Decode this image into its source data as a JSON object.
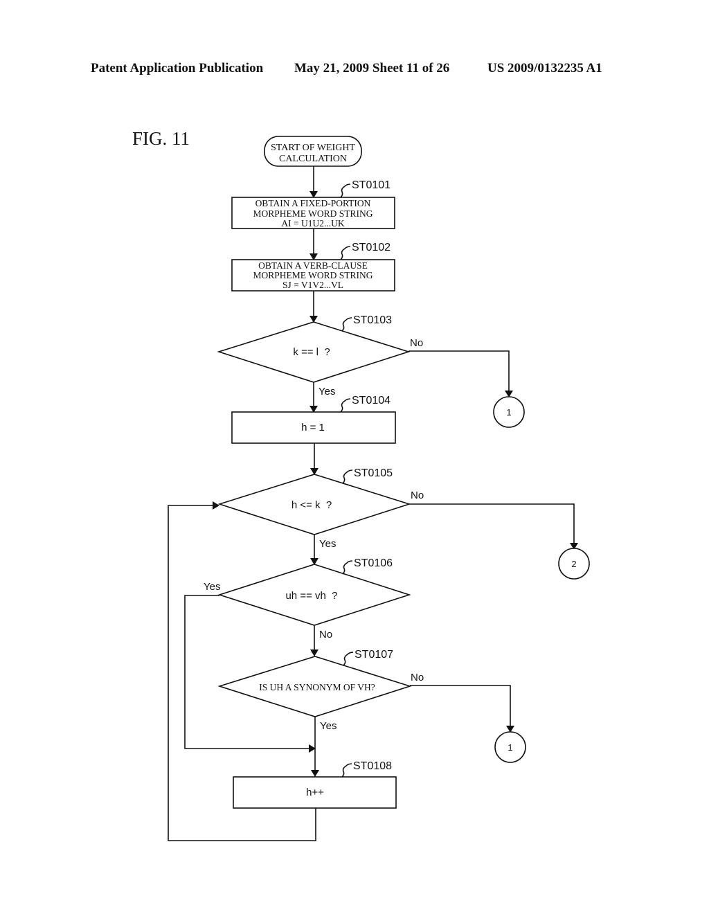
{
  "header": {
    "publication": "Patent Application Publication",
    "date_sheet": "May 21, 2009  Sheet 11 of 26",
    "pub_number": "US 2009/0132235 A1"
  },
  "figure": {
    "label": "FIG. 11",
    "start": {
      "lines": [
        "START OF WEIGHT",
        "CALCULATION"
      ]
    },
    "steps": [
      {
        "id": "ST0101",
        "type": "process",
        "lines": [
          "OBTAIN A FIXED-PORTION",
          "MORPHEME WORD STRING",
          "AI = U1U2...UK"
        ]
      },
      {
        "id": "ST0102",
        "type": "process",
        "lines": [
          "OBTAIN A VERB-CLAUSE",
          "MORPHEME WORD STRING",
          "SJ = V1V2...VL"
        ]
      },
      {
        "id": "ST0103",
        "type": "decision",
        "text": "k == l  ?",
        "yes": "Yes",
        "no": "No"
      },
      {
        "id": "ST0104",
        "type": "process",
        "text": "h = 1"
      },
      {
        "id": "ST0105",
        "type": "decision",
        "text": "h <= k  ?",
        "yes": "Yes",
        "no": "No"
      },
      {
        "id": "ST0106",
        "type": "decision",
        "text": "uh == vh  ?",
        "yes": "Yes",
        "no": "No"
      },
      {
        "id": "ST0107",
        "type": "decision",
        "text": "IS UH A SYNONYM OF VH?",
        "yes": "Yes",
        "no": "No"
      },
      {
        "id": "ST0108",
        "type": "process",
        "text": "h++"
      }
    ],
    "connectors": [
      {
        "label": "1",
        "from": "ST0103"
      },
      {
        "label": "2",
        "from": "ST0105"
      },
      {
        "label": "1",
        "from": "ST0107"
      }
    ]
  }
}
